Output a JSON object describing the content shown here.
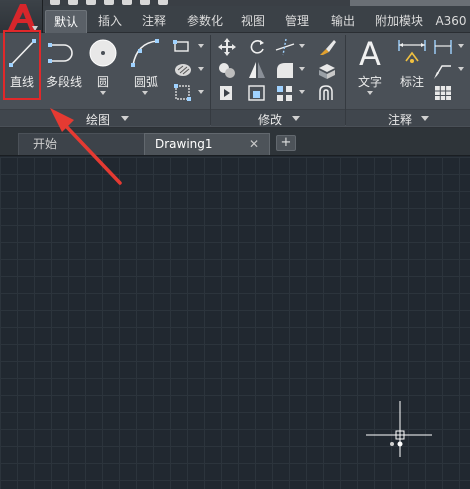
{
  "app": {
    "logo_letter": "A"
  },
  "ribbon_tabs": [
    {
      "label": "默认",
      "active": true
    },
    {
      "label": "插入"
    },
    {
      "label": "注释"
    },
    {
      "label": "参数化"
    },
    {
      "label": "视图"
    },
    {
      "label": "管理"
    },
    {
      "label": "输出"
    },
    {
      "label": "附加模块"
    },
    {
      "label": "A360"
    }
  ],
  "panels": {
    "draw": {
      "label": "绘图",
      "tools": [
        {
          "label": "直线",
          "icon": "line-icon"
        },
        {
          "label": "多段线",
          "icon": "polyline-icon"
        },
        {
          "label": "圆",
          "icon": "circle-icon"
        },
        {
          "label": "圆弧",
          "icon": "arc-icon"
        }
      ],
      "small_tools": [
        "rectangle-icon",
        "hatch-icon",
        "region-icon"
      ]
    },
    "modify": {
      "label": "修改",
      "small_tools": [
        "move-icon",
        "rotate-icon",
        "trim-icon",
        "erase-icon",
        "copy-icon",
        "mirror-icon",
        "fillet-icon",
        "explode-icon",
        "stretch-icon",
        "scale-icon",
        "array-icon",
        "offset-icon"
      ]
    },
    "annotation": {
      "label": "注释",
      "tools": [
        {
          "label": "文字",
          "icon": "text-icon"
        },
        {
          "label": "标注",
          "icon": "dimension-icon"
        }
      ],
      "small_tools": [
        "linear-dim-icon",
        "leader-icon",
        "table-icon"
      ]
    }
  },
  "file_tabs": [
    {
      "label": "开始"
    },
    {
      "label": "Drawing1",
      "active": true
    }
  ],
  "colors": {
    "highlight": "#e0282a",
    "accent_arrow": "#e53a32",
    "canvas": "#212830"
  }
}
